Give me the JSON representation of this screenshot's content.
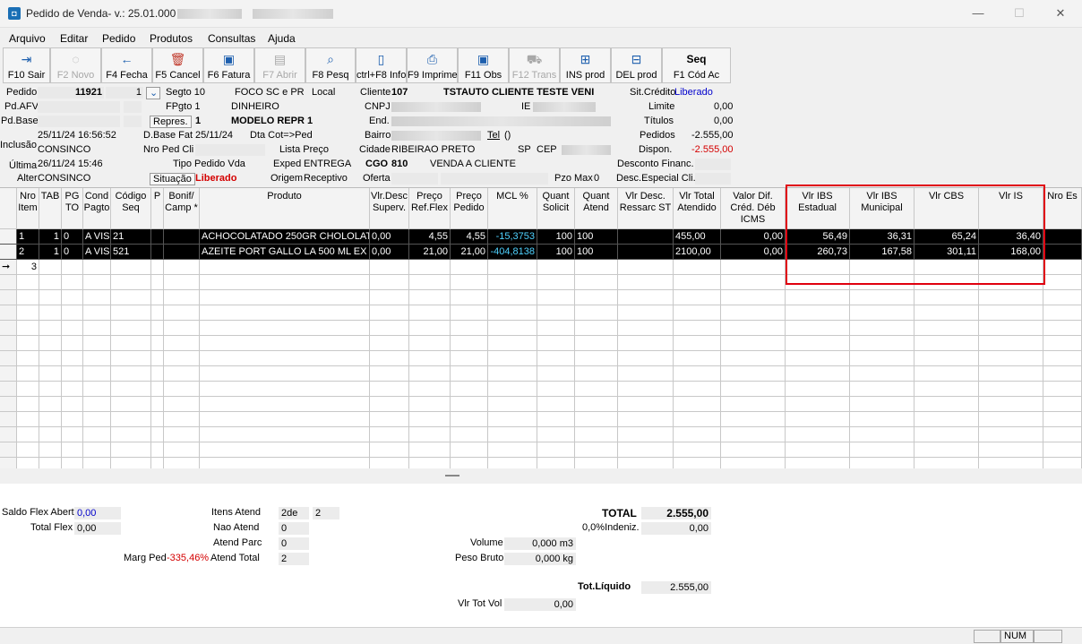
{
  "window": {
    "title": "Pedido de Venda- v.: 25.01.000",
    "app_icon": "app-icon",
    "min_icon": "—",
    "max_icon": "☐",
    "close_icon": "✕"
  },
  "menu": [
    "Arquivo",
    "Editar",
    "Pedido",
    "Produtos",
    "Consultas",
    "Ajuda"
  ],
  "toolbar": [
    {
      "label": "F10 Sair",
      "icon": "exit-icon",
      "glyph": "⇥",
      "enabled": true
    },
    {
      "label": "F2 Novo",
      "icon": "bulb-icon",
      "glyph": "◌",
      "enabled": false
    },
    {
      "label": "F4 Fecha",
      "icon": "arrow-left-icon",
      "glyph": "←",
      "enabled": true
    },
    {
      "label": "F5 Cancel",
      "icon": "trash-icon",
      "glyph": "🗑",
      "enabled": true
    },
    {
      "label": "F6 Fatura",
      "icon": "clipboard-icon",
      "glyph": "▣",
      "enabled": true
    },
    {
      "label": "F7 Abrir",
      "icon": "table-icon",
      "glyph": "▤",
      "enabled": false
    },
    {
      "label": "F8 Pesq",
      "icon": "search-icon",
      "glyph": "⌕",
      "enabled": true
    },
    {
      "label": "ctrl+F8 Info",
      "icon": "document-icon",
      "glyph": "▯",
      "enabled": true
    },
    {
      "label": "F9 Imprime",
      "icon": "printer-icon",
      "glyph": "⎙",
      "enabled": true
    },
    {
      "label": "F11 Obs",
      "icon": "clipboard-icon",
      "glyph": "▣",
      "enabled": true
    },
    {
      "label": "F12 Trans",
      "icon": "truck-icon",
      "glyph": "⛟",
      "enabled": false
    },
    {
      "label": "INS prod",
      "icon": "add-item-icon",
      "glyph": "⊞",
      "enabled": true
    },
    {
      "label": "DEL prod",
      "icon": "remove-item-icon",
      "glyph": "⊟",
      "enabled": true
    },
    {
      "label": "F1 Cód Ac",
      "icon": "seq-icon",
      "glyph": "Seq",
      "enabled": true
    }
  ],
  "header": {
    "pedido_label": "Pedido",
    "pedido_value": "11921",
    "pedido_seq": "1",
    "segto_label": "Segto 10",
    "segto_value": "FOCO SC e PR",
    "local_label": "Local",
    "cliente_label": "Cliente",
    "cliente_code": "107",
    "cliente_name": "TSTAUTO CLIENTE TESTE VENI",
    "sitcredito_label": "Sit.Crédito",
    "sitcredito_value": "Liberado",
    "pdafv_label": "Pd.AFV",
    "fpgto_label": "FPgto 1",
    "fpgto_value": "DINHEIRO",
    "cnpj_label": "CNPJ",
    "ie_label": "IE",
    "limite_label": "Limite",
    "limite_value": "0,00",
    "pdbase_label": "Pd.Base",
    "repres_btn": "Repres.",
    "repres_code": "1",
    "repres_name": "MODELO REPR 1",
    "end_label": "End.",
    "titulos_label": "Títulos",
    "titulos_value": "0,00",
    "inclusao_label": "Inclusão",
    "inclusao_date": "25/11/24 16:56:52",
    "dbasefat_label": "D.Base Fat",
    "dbasefat_value": "25/11/24",
    "dtcot_label": "Dta Cot=>Ped",
    "bairro_label": "Bairro",
    "tel_label": "Tel",
    "tel_value": "()",
    "pedidos_label": "Pedidos",
    "pedidos_value": "-2.555,00",
    "inclusao_user": "CONSINCO",
    "nropedcli_label": "Nro Ped Cli",
    "listapreco_label": "Lista Preço",
    "cidade_label": "Cidade",
    "cidade_value": "RIBEIRAO PRETO",
    "uf_value": "SP",
    "cep_label": "CEP",
    "dispon_label": "Dispon.",
    "dispon_value": "-2.555,00",
    "ultima_label": "Última",
    "ultima_date": "26/11/24 15:46",
    "tipopedido_label": "Tipo Pedido Vda",
    "exped_label": "Exped",
    "exped_value": "ENTREGA",
    "cgo_label": "CGO",
    "cgo_value": "810",
    "cgo_desc": "VENDA A CLIENTE",
    "descfinanc_label": "Desconto Financ.",
    "alter_label": "Alter",
    "alter_user": "CONSINCO",
    "situacao_btn": "Situação",
    "situacao_value": "Liberado",
    "origem_label": "Origem",
    "origem_value": "Receptivo",
    "oferta_label": "Oferta",
    "pzomax_label": "Pzo Max",
    "pzomax_value": "0",
    "descespecial_label": "Desc.Especial Cli."
  },
  "grid": {
    "columns": [
      "Nro Item",
      "TAB",
      "PG TO",
      "Cond Pagto",
      "Código Seq",
      "P",
      "Bonif/ Camp *",
      "Produto",
      "Vlr.Desc Superv.",
      "Preço Ref.Flex",
      "Preço Pedido",
      "MCL %",
      "Quant Solicit",
      "Quant Atend",
      "Vlr Desc. Ressarc ST",
      "Vlr Total Atendido",
      "Valor Dif. Créd. Déb ICMS",
      "Vlr IBS Estadual",
      "Vlr IBS Municipal",
      "Vlr CBS",
      "Vlr IS",
      "Nro Es"
    ],
    "rows": [
      [
        "1",
        "1",
        "0",
        "A VIS",
        "21",
        "",
        "",
        "ACHOCOLATADO 250GR CHOLOLAT",
        "0,00",
        "4,55",
        "4,55",
        "-15,3753",
        "100",
        "100",
        "",
        "455,00",
        "0,00",
        "56,49",
        "36,31",
        "65,24",
        "36,40",
        ""
      ],
      [
        "2",
        "1",
        "0",
        "A VIS",
        "521",
        "",
        "",
        "AZEITE PORT GALLO LA 500 ML EX",
        "0,00",
        "21,00",
        "21,00",
        "-404,8138",
        "100",
        "100",
        "",
        "2100,00",
        "0,00",
        "260,73",
        "167,58",
        "301,11",
        "168,00",
        ""
      ]
    ],
    "new_row_number": "3",
    "current_row_icon": "arrow-right-icon"
  },
  "footer": {
    "saldo_flex_label": "Saldo Flex Abert",
    "saldo_flex_value": "0,00",
    "total_flex_label": "Total Flex",
    "total_flex_value": "0,00",
    "marg_ped_label": "Marg Ped",
    "marg_ped_value": "-335,46%",
    "itens_atend_label": "Itens Atend",
    "itens_atend_value": "2de",
    "itens_total": "2",
    "nao_atend_label": "Nao Atend",
    "nao_atend_value": "0",
    "atend_parc_label": "Atend Parc",
    "atend_parc_value": "0",
    "atend_total_label": "Atend Total",
    "atend_total_value": "2",
    "volume_label": "Volume",
    "volume_value": "0,000 m3",
    "peso_label": "Peso Bruto",
    "peso_value": "0,000 kg",
    "vlr_tot_vol_label": "Vlr Tot Vol",
    "vlr_tot_vol_value": "0,00",
    "total_label": "TOTAL",
    "total_value": "2.555,00",
    "indeniz_label": "0,0%Indeniz.",
    "indeniz_value": "0,00",
    "tot_liquido_label": "Tot.Líquido",
    "tot_liquido_value": "2.555,00"
  },
  "statusbar": {
    "num_label": "NUM"
  },
  "colors": {
    "highlight_box": "#e0000f",
    "negative": "#d40000",
    "mcl_negative": "#4fd2ff",
    "link_blue": "#0000cc"
  }
}
